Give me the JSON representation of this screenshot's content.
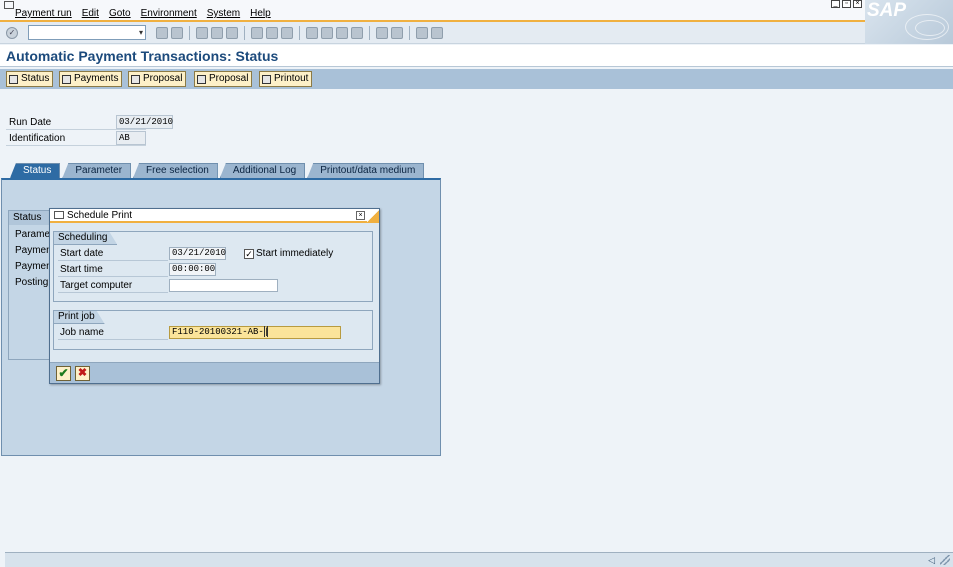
{
  "menu": {
    "items": [
      "Payment run",
      "Edit",
      "Goto",
      "Environment",
      "System",
      "Help"
    ]
  },
  "brand": {
    "logo_text": "SAP"
  },
  "toolbar": {
    "command_field_value": ""
  },
  "title": "Automatic Payment Transactions: Status",
  "app_toolbar": {
    "buttons": [
      "Status",
      "Payments",
      "Proposal",
      "Proposal",
      "Printout"
    ]
  },
  "header": {
    "run_date_label": "Run Date",
    "run_date_value": "03/21/2010",
    "identification_label": "Identification",
    "identification_value": "AB"
  },
  "tabs": [
    "Status",
    "Parameter",
    "Free selection",
    "Additional Log",
    "Printout/data medium"
  ],
  "status_box": {
    "header": "Status",
    "rows": [
      "Paramet",
      "Paymen",
      "Paymen",
      "Posting"
    ]
  },
  "dialog": {
    "title": "Schedule Print",
    "scheduling": {
      "title": "Scheduling",
      "start_date_label": "Start date",
      "start_date_value": "03/21/2010",
      "start_immediately_label": "Start immediately",
      "start_immediately_checked": true,
      "start_time_label": "Start time",
      "start_time_value": "00:00:00",
      "target_computer_label": "Target computer",
      "target_computer_value": ""
    },
    "print_job": {
      "title": "Print job",
      "job_name_label": "Job name",
      "job_name_value": "F110-20100321-AB-|"
    }
  }
}
